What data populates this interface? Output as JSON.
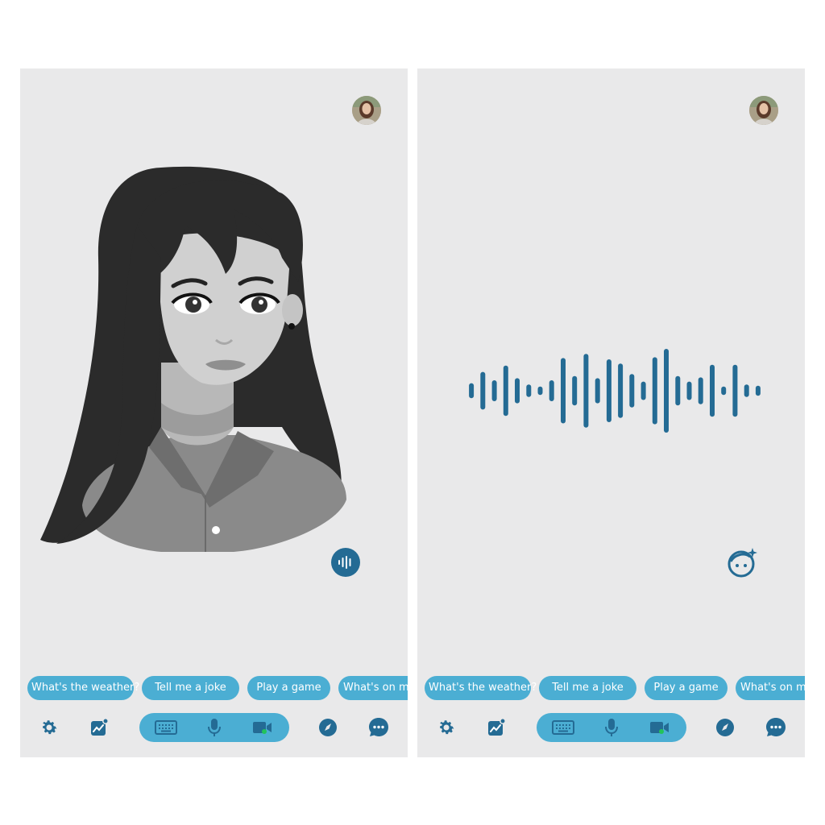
{
  "screens": [
    {
      "id": "avatar-view",
      "mode_button_icon": "voice-wave-icon",
      "suggestions": [
        "What's the weather?",
        "Tell me a joke",
        "Play a game",
        "What's on m"
      ],
      "toolbar": {
        "left_icons": [
          "gear-icon",
          "activity-chart-icon"
        ],
        "input_modes": [
          "keyboard-icon",
          "microphone-icon",
          "video-camera-icon"
        ],
        "right_icons": [
          "compass-icon",
          "chat-bubble-icon"
        ]
      }
    },
    {
      "id": "voice-view",
      "mode_button_icon": "avatar-face-icon",
      "suggestions": [
        "What's the weather?",
        "Tell me a joke",
        "Play a game",
        "What's on m"
      ],
      "toolbar": {
        "left_icons": [
          "gear-icon",
          "activity-chart-icon"
        ],
        "input_modes": [
          "keyboard-icon",
          "microphone-icon",
          "video-camera-icon"
        ],
        "right_icons": [
          "compass-icon",
          "chat-bubble-icon"
        ]
      },
      "waveform_levels": [
        0.18,
        0.45,
        0.25,
        0.6,
        0.3,
        0.15,
        0.1,
        0.25,
        0.78,
        0.35,
        0.88,
        0.3,
        0.75,
        0.65,
        0.4,
        0.22,
        0.8,
        1.0,
        0.35,
        0.22,
        0.32,
        0.62,
        0.1,
        0.62,
        0.15,
        0.12
      ]
    }
  ],
  "colors": {
    "background": "#e9e9ea",
    "primary_dark": "#246b94",
    "accent": "#4baed3",
    "video_dot": "#22c35a"
  }
}
